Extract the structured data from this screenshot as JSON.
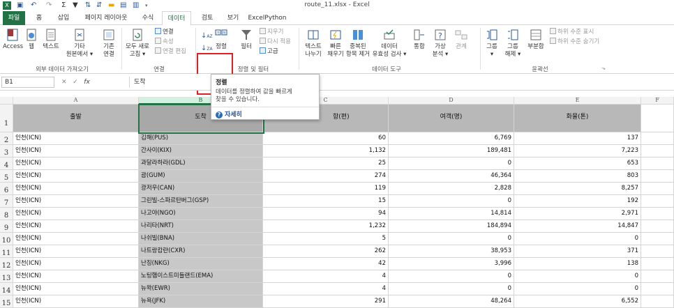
{
  "window": {
    "title": "route_11.xlsx - Excel",
    "quick_access": [
      "save-icon",
      "undo-icon",
      "redo-icon",
      "sum-icon",
      "filter-icon",
      "sort-asc-icon",
      "sort-desc-icon",
      "open-icon",
      "print-icon",
      "more-icon"
    ]
  },
  "tabs": [
    "파일",
    "홈",
    "삽입",
    "페이지 레이아웃",
    "수식",
    "데이터",
    "검토",
    "보기",
    "ExcelPython"
  ],
  "active_tab": "데이터",
  "ribbon": {
    "access": "Access",
    "web": "웹",
    "text": "텍스트",
    "other_line1": "기타",
    "other_line2": "원본에서 ▾",
    "existing_line1": "기존",
    "existing_line2": "연결",
    "refresh_line1": "모두 새로",
    "refresh_line2": "고침 ▾",
    "connections": "연결",
    "properties": "속성",
    "edit_links": "연결 편집",
    "sort_az": "↓",
    "sort_za": "↓",
    "sort": "정렬",
    "filter": "필터",
    "clear": "지우기",
    "reapply": "다시 적용",
    "advanced": "고급",
    "text_to_col_line1": "텍스트",
    "text_to_col_line2": "나누기",
    "flash_fill_line1": "빠른",
    "flash_fill_line2": "채우기",
    "remove_dup_line1": "중복된",
    "remove_dup_line2": "항목 제거",
    "validation_line1": "데이터",
    "validation_line2": "유효성 검사 ▾",
    "consolidate": "통합",
    "whatif_line1": "가상",
    "whatif_line2": "분석 ▾",
    "relationships": "관계",
    "group_line1": "그룹",
    "group_line2": "▾",
    "ungroup_line1": "그룹",
    "ungroup_line2": "해제 ▾",
    "subtotal": "부분합",
    "show_detail": "하위 수준 표시",
    "hide_detail": "하위 수준 숨기기",
    "groups": {
      "external": "외부 데이터 가져오기",
      "connections": "연결",
      "sort_filter": "정렬 및 필터",
      "data_tools": "데이터 도구",
      "outline": "윤곽선"
    }
  },
  "formula_bar": {
    "name_box": "B1",
    "fx": "fx",
    "value": "도착"
  },
  "tooltip": {
    "title": "정렬",
    "desc_line1": "데이터를 정렬하여 값을 빠르게",
    "desc_line2": "찾을 수 있습니다.",
    "more": "자세히"
  },
  "columns": [
    "A",
    "B",
    "C",
    "D",
    "E",
    "F"
  ],
  "headers": [
    "출발",
    "도착",
    "항(편)",
    "여객(명)",
    "화물(톤)"
  ],
  "rows": [
    {
      "num": "2",
      "from": "인천(ICN)",
      "to": "김해(PUS)",
      "flights": "60",
      "pax": "6,769",
      "cargo": "137"
    },
    {
      "num": "3",
      "from": "인천(ICN)",
      "to": "간사이(KIX)",
      "flights": "1,132",
      "pax": "189,481",
      "cargo": "7,223"
    },
    {
      "num": "4",
      "from": "인천(ICN)",
      "to": "과달라하라(GDL)",
      "flights": "25",
      "pax": "0",
      "cargo": "653"
    },
    {
      "num": "5",
      "from": "인천(ICN)",
      "to": "괌(GUM)",
      "flights": "274",
      "pax": "46,364",
      "cargo": "803"
    },
    {
      "num": "6",
      "from": "인천(ICN)",
      "to": "광저우(CAN)",
      "flights": "119",
      "pax": "2,828",
      "cargo": "8,257"
    },
    {
      "num": "7",
      "from": "인천(ICN)",
      "to": "그린빌-스파르탄버그(GSP)",
      "flights": "15",
      "pax": "0",
      "cargo": "192"
    },
    {
      "num": "8",
      "from": "인천(ICN)",
      "to": "나고야(NGO)",
      "flights": "94",
      "pax": "14,814",
      "cargo": "2,971"
    },
    {
      "num": "9",
      "from": "인천(ICN)",
      "to": "나리타(NRT)",
      "flights": "1,232",
      "pax": "184,894",
      "cargo": "14,847"
    },
    {
      "num": "10",
      "from": "인천(ICN)",
      "to": "나쉬빌(BNA)",
      "flights": "5",
      "pax": "0",
      "cargo": "0"
    },
    {
      "num": "11",
      "from": "인천(ICN)",
      "to": "나트랑캄란(CXR)",
      "flights": "262",
      "pax": "38,953",
      "cargo": "371"
    },
    {
      "num": "12",
      "from": "인천(ICN)",
      "to": "난징(NKG)",
      "flights": "42",
      "pax": "3,996",
      "cargo": "138"
    },
    {
      "num": "13",
      "from": "인천(ICN)",
      "to": "노팅햄이스트미들랜드(EMA)",
      "flights": "4",
      "pax": "0",
      "cargo": "0"
    },
    {
      "num": "14",
      "from": "인천(ICN)",
      "to": "뉴왁(EWR)",
      "flights": "4",
      "pax": "0",
      "cargo": "0"
    },
    {
      "num": "15",
      "from": "인천(ICN)",
      "to": "뉴욕(JFK)",
      "flights": "291",
      "pax": "48,264",
      "cargo": "6,552"
    }
  ]
}
